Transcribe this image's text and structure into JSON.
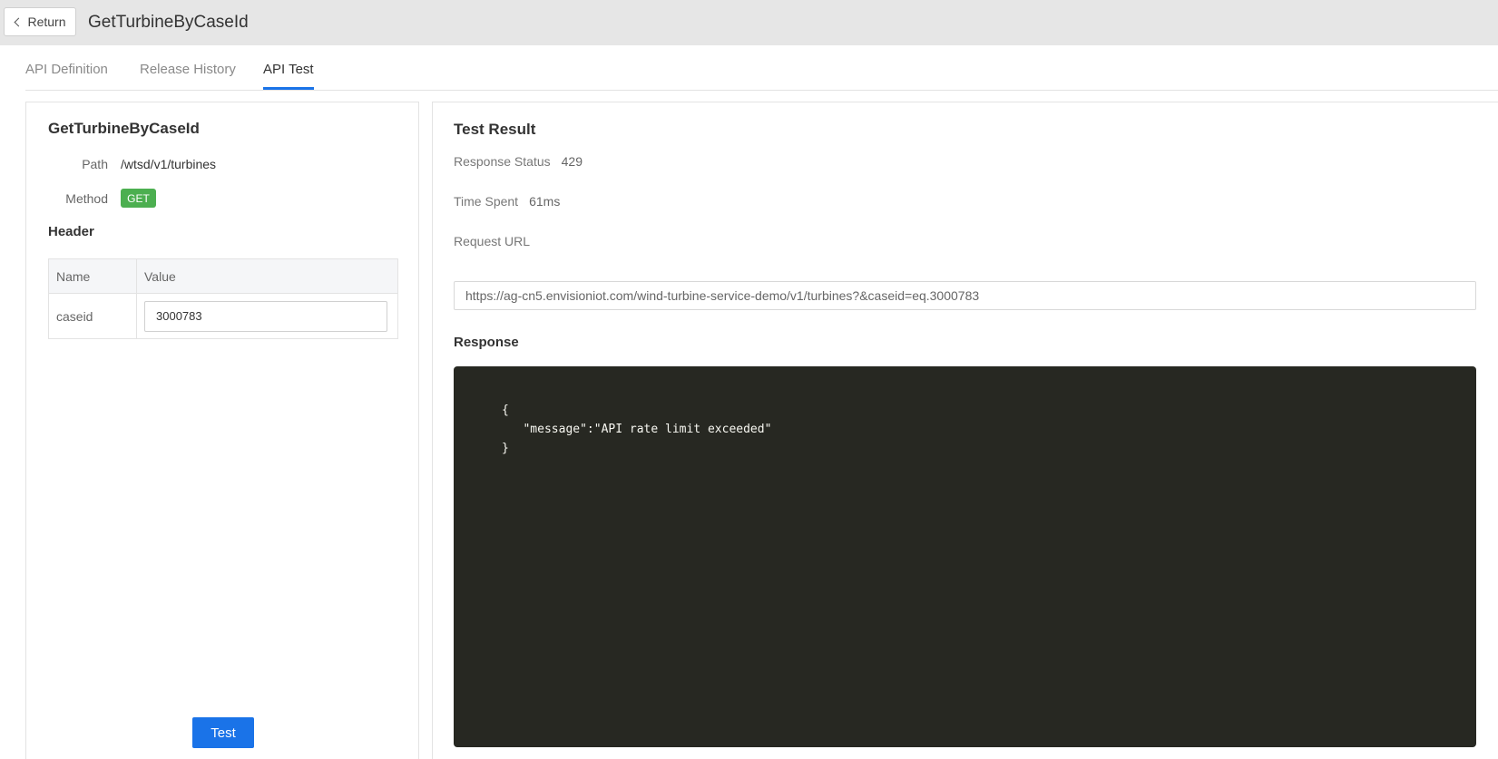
{
  "header": {
    "return_label": "Return",
    "title": "GetTurbineByCaseId"
  },
  "tabs": [
    {
      "label": "API Definition",
      "active": false
    },
    {
      "label": "Release History",
      "active": false
    },
    {
      "label": "API Test",
      "active": true
    }
  ],
  "left": {
    "title": "GetTurbineByCaseId",
    "path_label": "Path",
    "path_value": "/wtsd/v1/turbines",
    "method_label": "Method",
    "method_value": "GET",
    "header_title": "Header",
    "table": {
      "columns": [
        "Name",
        "Value"
      ],
      "rows": [
        {
          "name": "caseid",
          "value": "3000783"
        }
      ]
    },
    "test_button": "Test"
  },
  "right": {
    "title": "Test Result",
    "status_label": "Response Status",
    "status_value": "429",
    "time_label": "Time Spent",
    "time_value": "61ms",
    "url_label": "Request URL",
    "url_value": "https://ag-cn5.envisioniot.com/wind-turbine-service-demo/v1/turbines?&caseid=eq.3000783",
    "response_title": "Response",
    "response_lines": [
      "{",
      "   \"message\":\"API rate limit exceeded\"",
      "}"
    ]
  },
  "colors": {
    "accent": "#1a73e8",
    "method_badge": "#4caf50",
    "code_bg": "#272822"
  }
}
